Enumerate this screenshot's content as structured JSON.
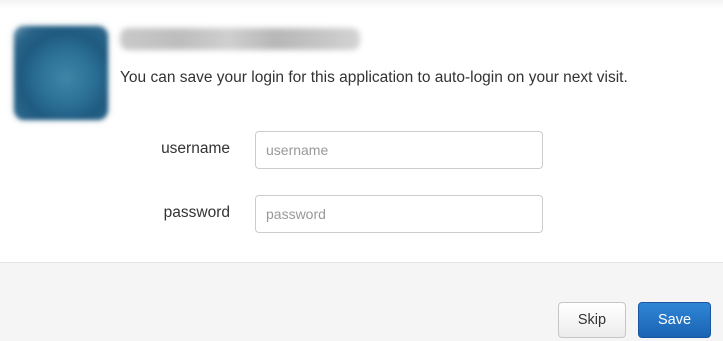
{
  "dialog": {
    "message": "You can save your login for this application to auto-login on your next visit.",
    "username": {
      "label": "username",
      "placeholder": "username",
      "value": ""
    },
    "password": {
      "label": "password",
      "placeholder": "password",
      "value": ""
    },
    "buttons": {
      "skip_label": "Skip",
      "save_label": "Save"
    }
  },
  "colors": {
    "primary_button": "#1f6fc4",
    "footer_background": "#f5f5f5",
    "input_border": "#cccccc"
  }
}
